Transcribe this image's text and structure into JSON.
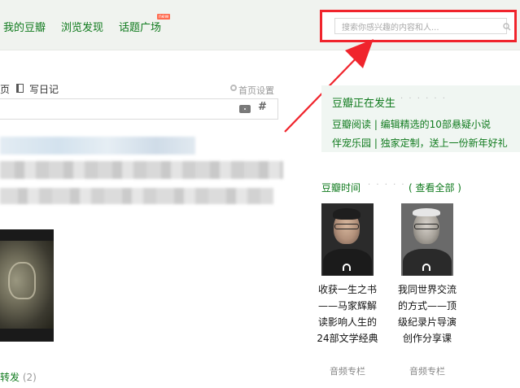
{
  "nav": {
    "items": [
      "我的豆瓣",
      "浏览发现",
      "话题广场"
    ],
    "new_badge": "new",
    "search_placeholder": "搜索你感兴趣的内容和人..."
  },
  "feed": {
    "tab_partial": "页",
    "diary_label": "写日记",
    "settings_label": "首页设置",
    "composer_hash": "#",
    "repost_label": "转发",
    "repost_count": "(2)"
  },
  "sidebar": {
    "happening_title": "豆瓣正在发生",
    "happening_dots": "· · · · · ·",
    "happening_items": [
      "豆瓣阅读 | 编辑精选的10部悬疑小说",
      "伴宠乐园 | 独家定制，送上一份新年好礼"
    ],
    "time_title": "豆瓣时间",
    "time_dots": "· · · · · ·",
    "time_all": "( 查看全部 )",
    "time_cards": [
      {
        "title": "收获一生之书——马家辉解读影响人生的24部文学经典",
        "tag": "音频专栏"
      },
      {
        "title": "我同世界交流的方式——顶级纪录片导演创作分享课",
        "tag": "音频专栏"
      }
    ]
  },
  "colors": {
    "brand_green": "#0f7a1d",
    "highlight_red": "#f0242c",
    "nav_bg": "#f0f3ef"
  },
  "icons": [
    "search-icon",
    "diary-icon",
    "gear-icon",
    "camera-icon",
    "hash-icon",
    "headphone-icon"
  ]
}
